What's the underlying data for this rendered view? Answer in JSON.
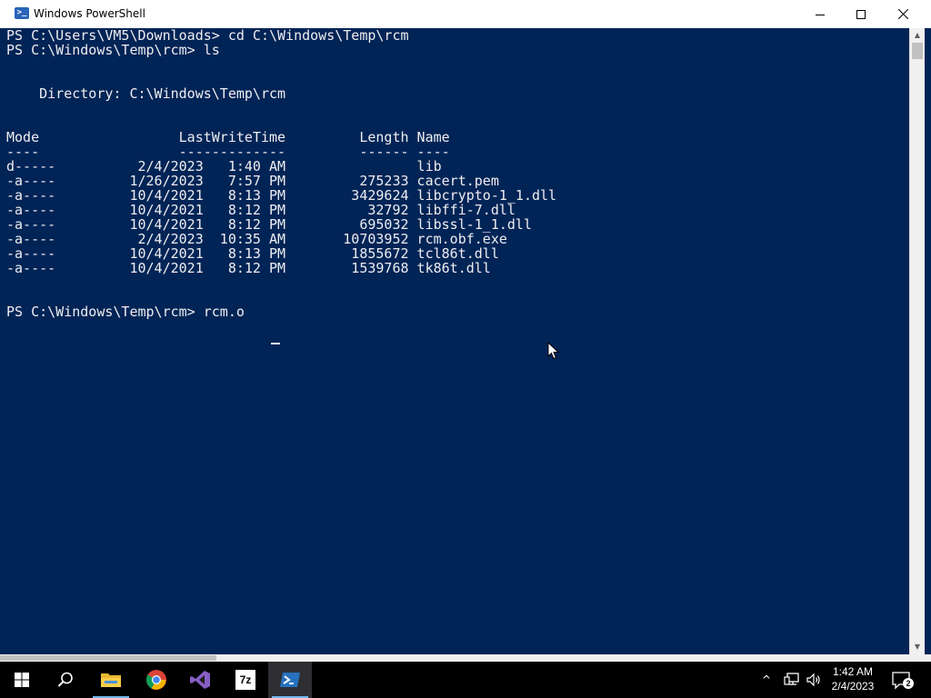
{
  "window": {
    "title": "Windows PowerShell",
    "icon": "powershell-icon",
    "controls": {
      "minimize": "minimize-icon",
      "maximize": "maximize-icon",
      "close": "close-icon"
    }
  },
  "console": {
    "background": "#012456",
    "foreground": "#eeedf0",
    "lines": [
      "PS C:\\Users\\VM5\\Downloads> cd C:\\Windows\\Temp\\rcm",
      "PS C:\\Windows\\Temp\\rcm> ls",
      "",
      "",
      "    Directory: C:\\Windows\\Temp\\rcm",
      "",
      "",
      "Mode                 LastWriteTime         Length Name",
      "----                 -------------         ------ ----",
      "d-----          2/4/2023   1:40 AM                lib",
      "-a----         1/26/2023   7:57 PM         275233 cacert.pem",
      "-a----         10/4/2021   8:13 PM        3429624 libcrypto-1_1.dll",
      "-a----         10/4/2021   8:12 PM          32792 libffi-7.dll",
      "-a----         10/4/2021   8:12 PM         695032 libssl-1_1.dll",
      "-a----          2/4/2023  10:35 AM       10703952 rcm.obf.exe",
      "-a----         10/4/2021   8:13 PM        1855672 tcl86t.dll",
      "-a----         10/4/2021   8:12 PM        1539768 tk86t.dll",
      "",
      "",
      "PS C:\\Windows\\Temp\\rcm> rcm.o"
    ]
  },
  "taskbar": {
    "apps": [
      {
        "name": "start-icon",
        "active": false
      },
      {
        "name": "search-icon",
        "active": false
      },
      {
        "name": "file-explorer-icon",
        "active": false
      },
      {
        "name": "chrome-icon",
        "active": false
      },
      {
        "name": "visual-studio-icon",
        "active": false
      },
      {
        "name": "7zip-icon",
        "label": "7z",
        "active": false
      },
      {
        "name": "powershell-icon",
        "active": true
      }
    ],
    "tray": {
      "chevron": "^",
      "icons": [
        "network-icon",
        "volume-icon"
      ],
      "time": "1:42 AM",
      "date": "2/4/2023",
      "notification_count": "2"
    }
  }
}
